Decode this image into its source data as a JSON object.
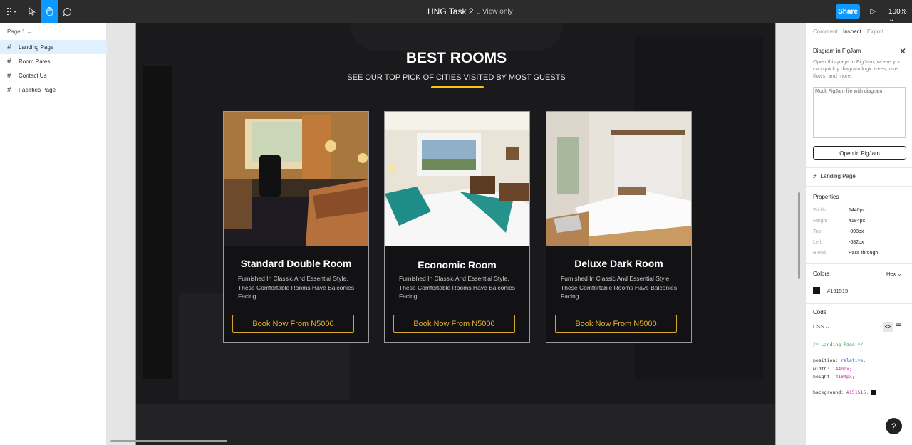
{
  "toolbar": {
    "file_title": "HNG Task 2",
    "view_mode": "View only",
    "share_label": "Share",
    "zoom": "100%"
  },
  "pages": {
    "current_page": "Page 1",
    "layers": [
      "Landing Page",
      "Room Rates",
      "Contact Us",
      "Facilities Page"
    ]
  },
  "canvas": {
    "section_title": "BEST ROOMS",
    "section_subtitle": "SEE OUR TOP PICK OF CITIES VISITED BY MOST GUESTS",
    "accent_color": "#f5c518",
    "cards": [
      {
        "name": "Standard Double Room",
        "desc": "Furnished In Classic And Essential Style, These Comfortable Rooms Have Balconies Facing.....",
        "cta": "Book Now From N5000"
      },
      {
        "name": "Economic Room",
        "desc": "Furnished In Classic And Essential Style, These Comfortable Rooms Have Balconies Facing.....",
        "cta": "Book Now From N5000"
      },
      {
        "name": "Deluxe Dark Room",
        "desc": "Furnished In Classic And Essential Style, These Comfortable Rooms Have Balconies Facing.....",
        "cta": "Book Now From N5000"
      }
    ]
  },
  "inspector": {
    "tabs": [
      "Comment",
      "Inspect",
      "Export"
    ],
    "active_tab": "Inspect",
    "figjam_title": "Diagram in FigJam",
    "figjam_text": "Open this page in FigJam, where you can quickly diagram logic trees, user flows, and more.",
    "figjam_img_alt": "Mock FigJam file with diagram",
    "open_figjam": "Open in FigJam",
    "selected_layer": "Landing Page",
    "properties_title": "Properties",
    "properties": [
      {
        "key": "Width",
        "value": "1440px"
      },
      {
        "key": "Height",
        "value": "4184px"
      },
      {
        "key": "Top",
        "value": "-808px"
      },
      {
        "key": "Left",
        "value": "-682px"
      },
      {
        "key": "Blend",
        "value": "Pass through"
      }
    ],
    "colors_title": "Colors",
    "color_format": "Hex",
    "color_value": "#151515",
    "code_title": "Code",
    "code_lang": "CSS",
    "code_lines": {
      "comment": "/* Landing Page */",
      "position_prop": "position:",
      "position_val": "relative;",
      "width_prop": "width:",
      "width_val": "1440px;",
      "height_prop": "height:",
      "height_val": "4184px;",
      "bg_prop": "background:",
      "bg_val": "#151515;"
    }
  }
}
